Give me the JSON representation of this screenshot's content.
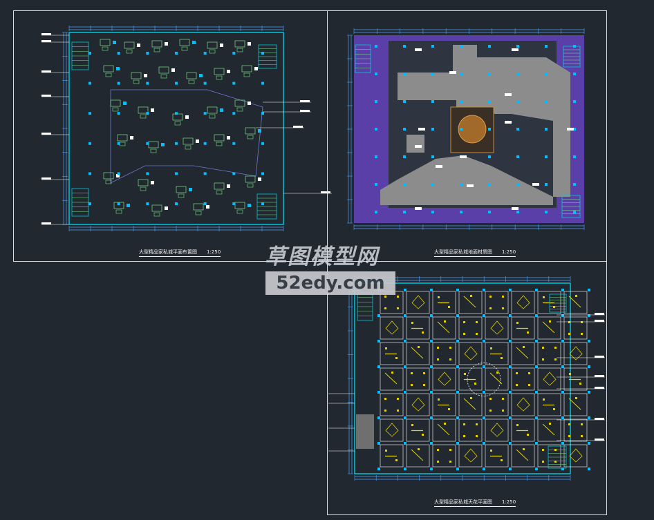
{
  "drawing": {
    "sheets": [
      {
        "id": "furniture-layout",
        "title": "大型精品家私城平面布置图",
        "scale": "1:250"
      },
      {
        "id": "floor-material",
        "title": "大型精品家私城地面材质图",
        "scale": "1:250"
      },
      {
        "id": "ceiling-plan",
        "title": "大型精品家私城天花平面图",
        "scale": "1:250"
      }
    ]
  },
  "watermark": {
    "name": "草图模型网",
    "url": "52edy.com"
  },
  "colors": {
    "background": "#212830",
    "frame": "#d8dde2",
    "wall": "#00c8d8",
    "furniture": "#7fe08a",
    "floor_slab": "#5b3fa8",
    "floor_tile": "#2e3540",
    "floor_feature": "#8c8c8c",
    "light_fixture": "#e6d200",
    "column": "#00bfff",
    "dimension": "#4fa3ff"
  }
}
